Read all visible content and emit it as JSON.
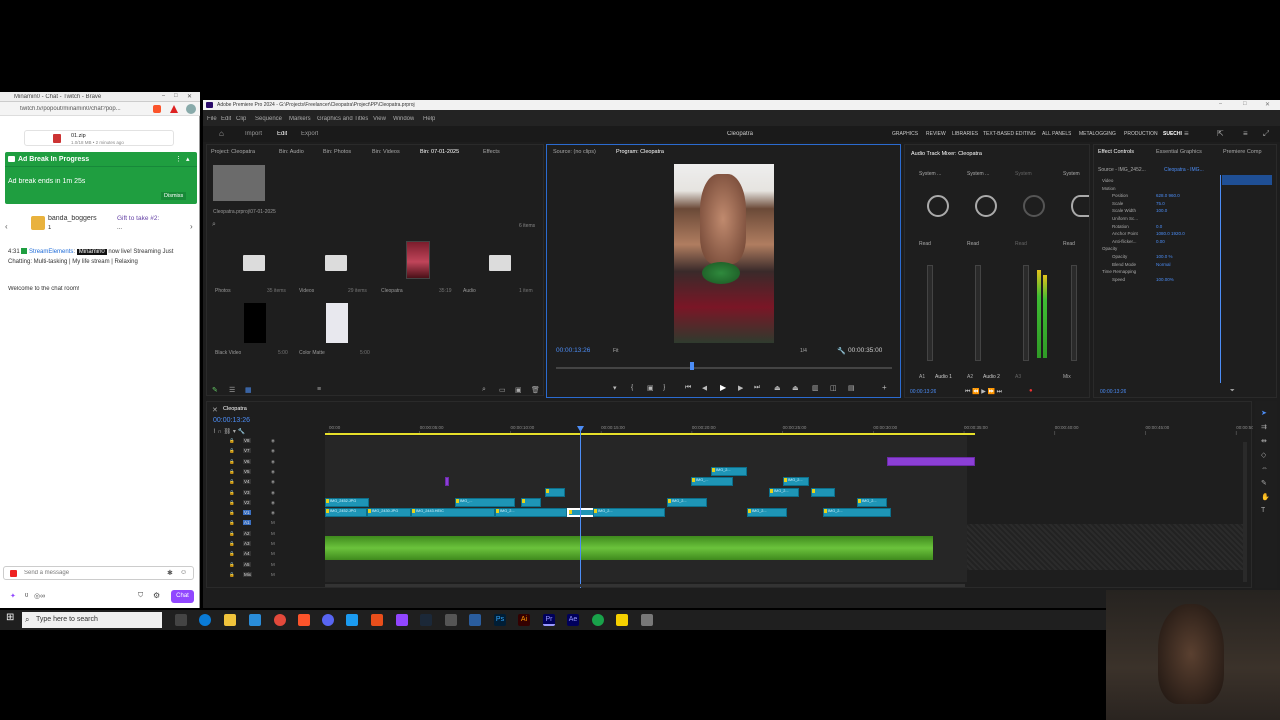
{
  "chat": {
    "window_title": "Minamin0 - Chat - Twitch - Brave",
    "url": "twitch.tv/popout/minamin0/chat?pop...",
    "download": {
      "name": "01.zip",
      "detail": "1.0/18 MB • 2 minutes ago"
    },
    "ad_banner": {
      "title": "Ad Break In Progress",
      "countdown": "Ad break ends in 1m 25s",
      "dismiss": "Dismiss"
    },
    "gift": {
      "user": "banda_boggers",
      "count": "1",
      "text": "Gift to take #2:",
      "sub": "..."
    },
    "message": {
      "time": "4:31",
      "user": "StreamElements",
      "mention": "Minamin0",
      "text": "now live! Streaming Just Chatting: Multi-tasking | My life stream | Relaxing"
    },
    "welcome": "Welcome to the chat room!",
    "input_placeholder": "Send a message",
    "points": "0",
    "chat_button": "Chat"
  },
  "premiere": {
    "title": "Adobe Premiere Pro 2024 - G:\\Projects\\Freelancer\\Cleopatra\\Project\\PP\\Cleopatra.prproj",
    "menu": [
      "File",
      "Edit",
      "Clip",
      "Sequence",
      "Markers",
      "Graphics and Titles",
      "View",
      "Window",
      "Help"
    ],
    "nav": {
      "import": "Import",
      "edit": "Edit",
      "export": "Export"
    },
    "project_name": "Cleopatra",
    "workspaces": [
      "GRAPHICS",
      "REVIEW",
      "LIBRARIES",
      "TEXT-BASED EDITING",
      "ALL PANELS",
      "METALOGGING",
      "PRODUCTION",
      "SUECHI"
    ],
    "project_tabs": [
      "Project: Cleopatra",
      "Bin: Audio",
      "Bin: Photos",
      "Bin: Videos",
      "Bin: 07-01-2025",
      "Effects"
    ],
    "project_path": "Cleopatra.prproj\\07-01-2025",
    "item_count": "6 items",
    "bins": [
      {
        "name": "Photos",
        "count": "35 items"
      },
      {
        "name": "Videos",
        "count": "29 items"
      },
      {
        "name": "Cleopatra",
        "count": "35:19"
      },
      {
        "name": "Audio",
        "count": "1 item"
      },
      {
        "name": "Black Video",
        "count": "5:00"
      },
      {
        "name": "Color Matte",
        "count": "5:00"
      }
    ],
    "source_tab": "Source: (no clips)",
    "program_tab": "Program: Cleopatra",
    "program_timecode": "00:00:13:26",
    "fit": "Fit",
    "quality": "1/4",
    "program_duration": "00:00:35:00",
    "mixer_title": "Audio Track Mixer: Cleopatra",
    "mixer_channels": [
      {
        "name": "System ...",
        "mode": "Read",
        "label": "A1",
        "track": "Audio 1"
      },
      {
        "name": "System ...",
        "mode": "Read",
        "label": "A2",
        "track": "Audio 2"
      },
      {
        "name": "System",
        "mode": "Read",
        "label": "A3",
        "track": "Audio 3"
      },
      {
        "name": "System",
        "mode": "Read",
        "label": "Mix",
        "track": "Mix"
      }
    ],
    "effect_tabs": [
      "Effect Controls",
      "Essential Graphics",
      "Premiere Comp"
    ],
    "effect_source": "Source - IMG_2452...",
    "effect_seq": "Cleopatra - IMG...",
    "effects": [
      {
        "name": "Video",
        "value": ""
      },
      {
        "name": "Motion",
        "value": ""
      },
      {
        "name": "Position",
        "value": "628.0  960.0"
      },
      {
        "name": "Scale",
        "value": "75.0"
      },
      {
        "name": "Scale Width",
        "value": "100.0"
      },
      {
        "name": "Uniform Sc...",
        "value": ""
      },
      {
        "name": "Rotation",
        "value": "0.0"
      },
      {
        "name": "Anchor Point",
        "value": "1080.0  1920.0"
      },
      {
        "name": "Anti-flicker...",
        "value": "0.00"
      },
      {
        "name": "Opacity",
        "value": ""
      },
      {
        "name": "Opacity",
        "value": "100.0 %"
      },
      {
        "name": "Blend Mode",
        "value": "Normal"
      },
      {
        "name": "Time Remapping",
        "value": ""
      },
      {
        "name": "Speed",
        "value": "100.00%"
      }
    ],
    "effect_timecode": "00:00:13:26",
    "timeline_tab": "Cleopatra",
    "timeline_timecode": "00:00:13:26",
    "ruler": [
      "00:00",
      "00:00:05:00",
      "00:00:10:00",
      "00:00:15:00",
      "00:00:20:00",
      "00:00:25:00",
      "00:00:30:00",
      "00:00:35:00",
      "00:00:40:00",
      "00:00:45:00",
      "00:00:50:00"
    ],
    "tracks": [
      "V8",
      "V7",
      "V6",
      "V5",
      "V4",
      "V3",
      "V2",
      "V1",
      "A1",
      "A2",
      "A3",
      "A4",
      "A5",
      "Mix"
    ],
    "clip_labels": [
      "IMG_2452.JPG",
      "IMG_2430.JPG",
      "IMG_2443.HEIC",
      "IMG_2...",
      "IMG_...",
      "IMG_2...",
      "IMG_2...",
      "IMG_2...",
      "IMG_2...",
      "IMG_2..."
    ],
    "playhead_progress": 0.4
  },
  "taskbar": {
    "search_placeholder": "Type here to search"
  }
}
